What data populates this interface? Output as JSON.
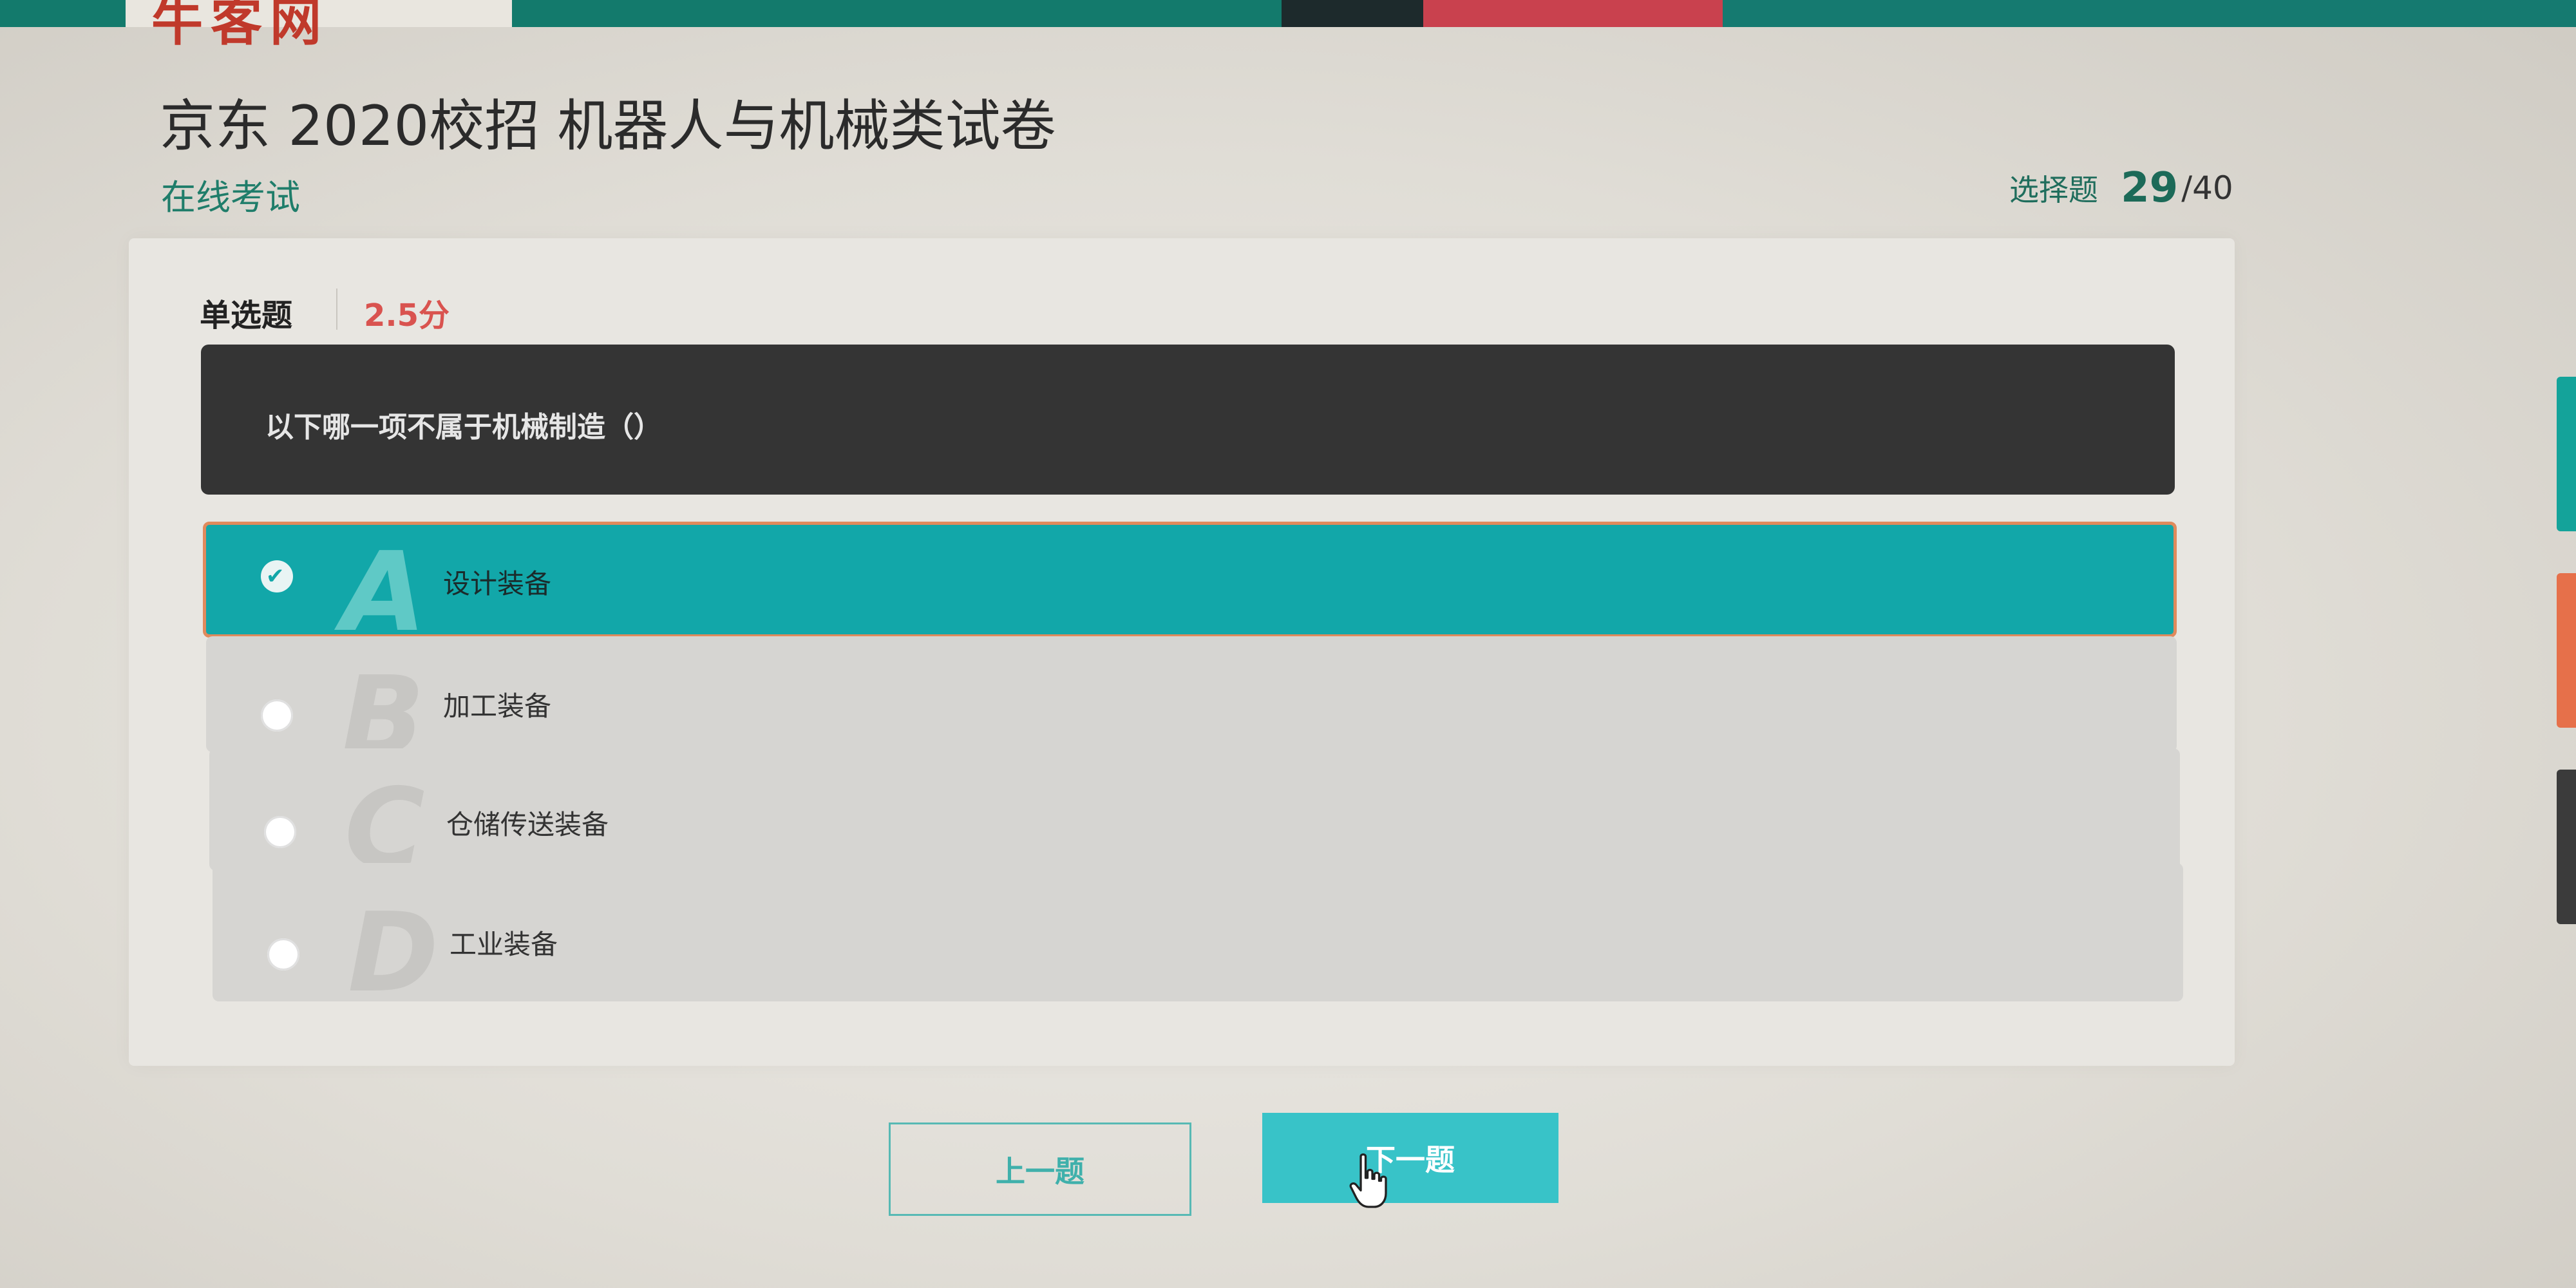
{
  "header": {
    "logo_text": "牛客网"
  },
  "exam": {
    "title": "京东 2020校招 机器人与机械类试卷",
    "subtitle": "在线考试"
  },
  "progress": {
    "label": "选择题",
    "current": "29",
    "total": "/40"
  },
  "question": {
    "type": "单选题",
    "score": "2.5分",
    "text": "以下哪一项不属于机械制造（）",
    "options": [
      {
        "letter": "A",
        "text": "设计装备",
        "selected": true
      },
      {
        "letter": "B",
        "text": "加工装备",
        "selected": false
      },
      {
        "letter": "C",
        "text": "仓储传送装备",
        "selected": false
      },
      {
        "letter": "D",
        "text": "工业装备",
        "selected": false
      }
    ]
  },
  "nav": {
    "prev_label": "上一题",
    "next_label": "下一题"
  },
  "colors": {
    "accent": "#12a7a9",
    "score": "#d9534f",
    "question_bg": "#343434",
    "selected_border": "#e08a5c"
  },
  "icons": {
    "selected_option": "check-icon",
    "cursor": "hand-pointer-icon"
  }
}
